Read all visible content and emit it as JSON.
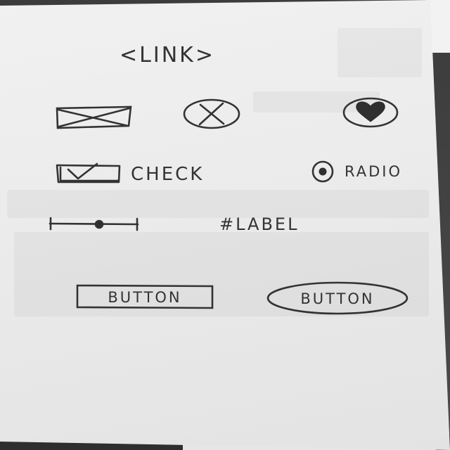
{
  "sketch": {
    "link_text": "<LINK>",
    "checkbox_label": "CHECK",
    "radio_label": "RADIO",
    "label_text": "#LABEL",
    "button_rect_label": "BUTTON",
    "button_pill_label": "BUTTON"
  },
  "icons": {
    "image_placeholder": "image-placeholder-icon",
    "close_circle": "close-circle-icon",
    "heart": "heart-icon",
    "checkbox": "checkbox-checked-icon",
    "radio": "radio-selected-icon",
    "slider": "slider-icon"
  },
  "colors": {
    "ink": "#333333",
    "paper": "#ececec"
  }
}
